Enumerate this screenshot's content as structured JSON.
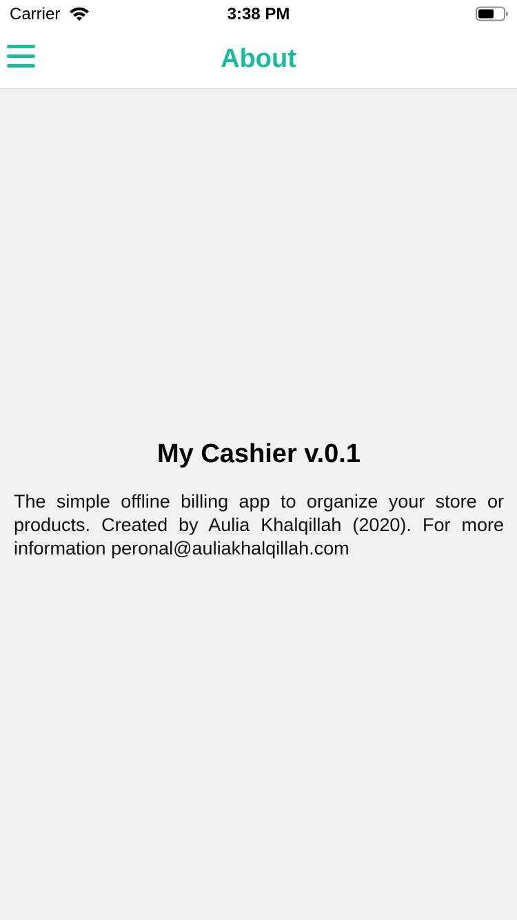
{
  "status_bar": {
    "carrier": "Carrier",
    "time": "3:38 PM"
  },
  "nav": {
    "title": "About",
    "accent_color": "#1abc9c",
    "menu_icon": "hamburger-icon"
  },
  "about": {
    "app_title": "My Cashier v.0.1",
    "description": "The simple offline billing app to organize your store or products. Created by Aulia Khalqillah (2020). For more information peronal@auliakhalqillah.com"
  }
}
